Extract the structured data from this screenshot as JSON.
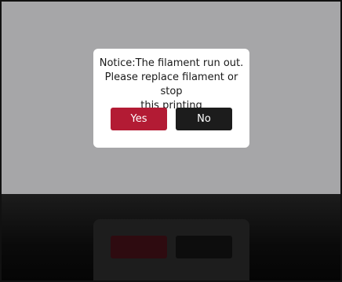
{
  "dialog": {
    "message_lines": [
      "Notice:The filament run out.",
      "Please replace filament or stop",
      "this printing"
    ],
    "yes_label": "Yes",
    "no_label": "No"
  },
  "colors": {
    "backdrop": "#a6a6a8",
    "yes_button": "#b31b34",
    "no_button": "#1c1c1c",
    "dialog_bg": "#ffffff"
  }
}
